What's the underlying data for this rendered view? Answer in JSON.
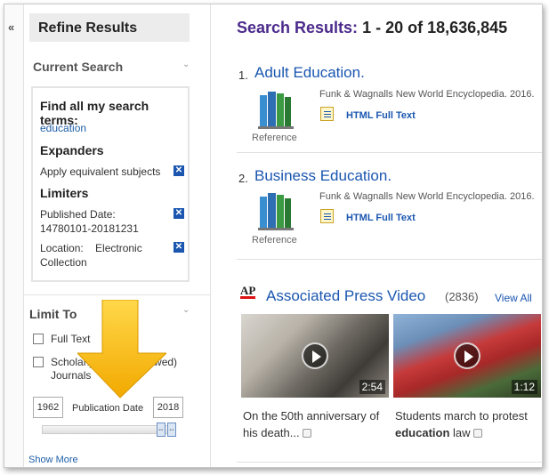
{
  "sidebar": {
    "collapse_label": "«",
    "refine_title": "Refine Results",
    "current_search": {
      "title": "Current Search",
      "find_heading": "Find all my search terms:",
      "term": "education",
      "expanders_heading": "Expanders",
      "expander": "Apply equivalent subjects",
      "limiters_heading": "Limiters",
      "limiter_date": "Published Date: 14780101-20181231",
      "limiter_location": "Location:    Electronic Collection"
    },
    "limit_to": {
      "title": "Limit To",
      "full_text": "Full Text",
      "scholarly": "Scholarly (Peer Reviewed) Journals",
      "date_from": "1962",
      "date_label": "Publication Date",
      "date_to": "2018",
      "date_handle_left": "⇔",
      "date_handle_right": "⇔",
      "show_more": "Show More"
    }
  },
  "main": {
    "title_label": "Search Results:",
    "title_count": "1 - 20 of 18,636,845",
    "results": [
      {
        "num": "1.",
        "title": "Adult Education.",
        "source": "Funk & Wagnalls New World Encyclopedia. 2016.",
        "type": "Reference",
        "full_text": "HTML Full Text"
      },
      {
        "num": "2.",
        "title": "Business Education.",
        "source": "Funk & Wagnalls New World Encyclopedia. 2016.",
        "type": "Reference",
        "full_text": "HTML Full Text"
      }
    ],
    "ap": {
      "logo": "AP",
      "title": "Associated Press Video",
      "count": "(2836)",
      "view_all": "View All",
      "videos": [
        {
          "duration": "2:54",
          "caption": "On the 50th anniversary of his death..."
        },
        {
          "duration": "1:12",
          "caption_pre": "Students march to protest ",
          "caption_bold": "education",
          "caption_post": " law"
        }
      ]
    }
  },
  "colors": {
    "link": "#1a56b0",
    "results_label": "#4b2a8a",
    "arrow": "#f4b400",
    "limiter_x": "#1a56b0"
  }
}
